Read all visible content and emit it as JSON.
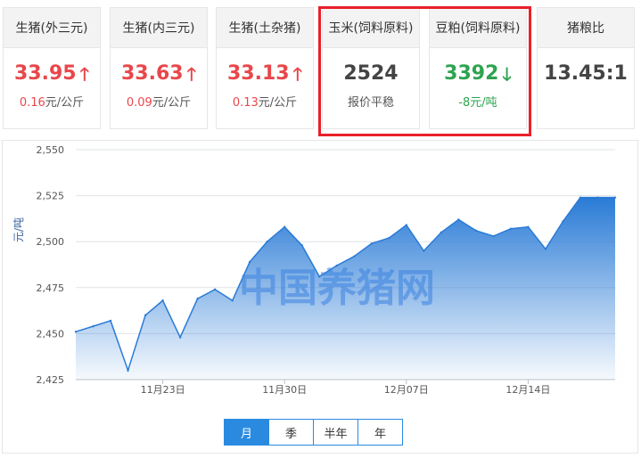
{
  "cards": [
    {
      "title": "生猪(外三元)",
      "price": "33.95",
      "arrow": "🡑",
      "sub": "0.16",
      "unit": "元/公斤"
    },
    {
      "title": "生猪(内三元)",
      "price": "33.63",
      "arrow": "🡑",
      "sub": "0.09",
      "unit": "元/公斤"
    },
    {
      "title": "生猪(土杂猪)",
      "price": "33.13",
      "arrow": "🡑",
      "sub": "0.13",
      "unit": "元/公斤"
    },
    {
      "title": "玉米(饲料原料)",
      "price": "2524",
      "sub": "报价平稳"
    },
    {
      "title": "豆粕(饲料原料)",
      "price": "3392",
      "arrow": "🡓",
      "sub": "-8元/吨"
    },
    {
      "title": "猪粮比",
      "price": "13.45:1"
    }
  ],
  "colors": {
    "up": "#e8474b",
    "down": "#2ea44f",
    "accent": "#2a8ae0",
    "highlight": "#e8202a"
  },
  "watermark": "中国养猪网",
  "ranges": [
    "月",
    "季",
    "半年",
    "年"
  ],
  "active_range": "月",
  "chart_data": {
    "type": "area",
    "ylabel": "元/吨",
    "ylim": [
      2425,
      2550
    ],
    "yticks": [
      "2,550",
      "2,525",
      "2,500",
      "2,475",
      "2,450",
      "2,425"
    ],
    "ytick_values": [
      2550,
      2525,
      2500,
      2475,
      2450,
      2425
    ],
    "xticks": [
      "11月23日",
      "11月30日",
      "12月07日",
      "12月14日"
    ],
    "x": [
      "11-18",
      "11-19",
      "11-20",
      "11-21",
      "11-22",
      "11-23",
      "11-24",
      "11-25",
      "11-26",
      "11-27",
      "11-28",
      "11-29",
      "11-30",
      "12-01",
      "12-02",
      "12-03",
      "12-04",
      "12-05",
      "12-06",
      "12-07",
      "12-08",
      "12-09",
      "12-10",
      "12-11",
      "12-12",
      "12-13",
      "12-14",
      "12-15",
      "12-16",
      "12-17",
      "12-18",
      "12-19"
    ],
    "values": [
      2451,
      2454,
      2457,
      2430,
      2460,
      2468,
      2448,
      2469,
      2474,
      2468,
      2489,
      2500,
      2508,
      2498,
      2481,
      2487,
      2492,
      2499,
      2502,
      2509,
      2495,
      2505,
      2512,
      2506,
      2503,
      2507,
      2508,
      2496,
      2511,
      2524,
      2524,
      2524
    ],
    "xtick_index": [
      5,
      12,
      19,
      26
    ]
  }
}
